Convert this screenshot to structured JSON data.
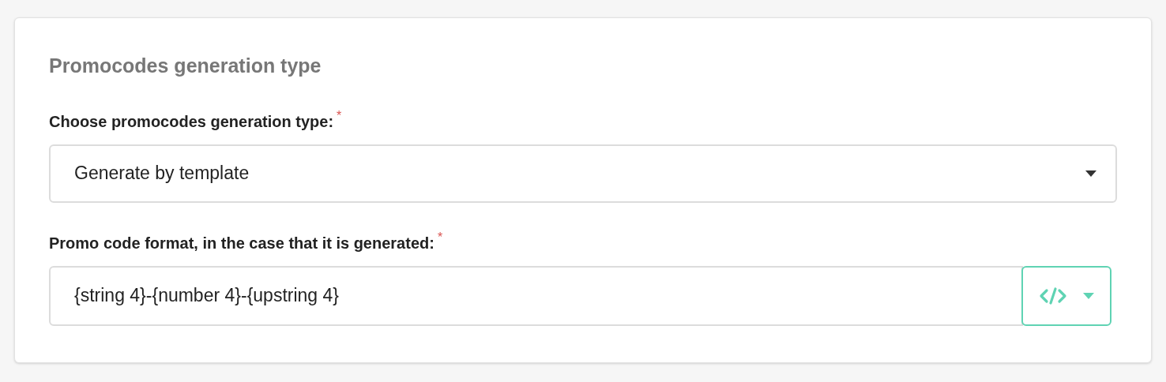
{
  "section": {
    "title": "Promocodes generation type"
  },
  "fields": [
    {
      "kind": "select",
      "label": "Choose promocodes generation type:",
      "required_mark": "*",
      "value": "Generate by template"
    },
    {
      "kind": "template",
      "label": "Promo code format, in the case that it is generated:",
      "required_mark": "*",
      "value": "{string 4}-{number 4}-{upstring 4}"
    }
  ]
}
